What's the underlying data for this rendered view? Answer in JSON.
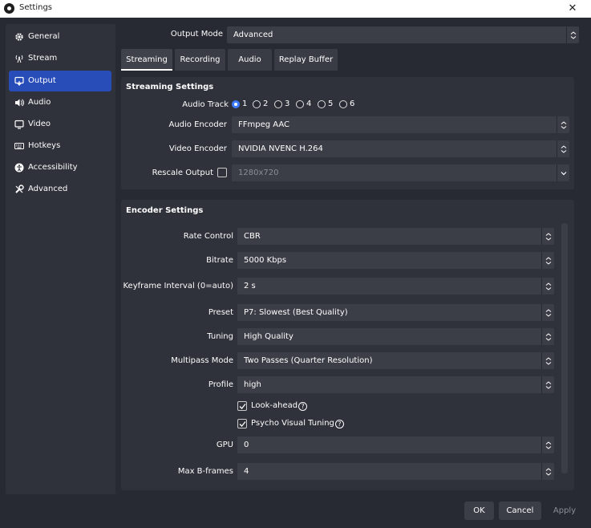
{
  "window": {
    "title": "Settings",
    "close_glyph": "✕"
  },
  "sidebar": {
    "items": [
      {
        "label": "General",
        "icon": "gear-icon"
      },
      {
        "label": "Stream",
        "icon": "antenna-icon"
      },
      {
        "label": "Output",
        "icon": "output-icon",
        "active": true
      },
      {
        "label": "Audio",
        "icon": "speaker-icon"
      },
      {
        "label": "Video",
        "icon": "monitor-icon"
      },
      {
        "label": "Hotkeys",
        "icon": "keyboard-icon"
      },
      {
        "label": "Accessibility",
        "icon": "accessibility-icon"
      },
      {
        "label": "Advanced",
        "icon": "wrench-icon"
      }
    ]
  },
  "output_mode": {
    "label": "Output Mode",
    "value": "Advanced"
  },
  "tabs": [
    {
      "label": "Streaming",
      "active": true
    },
    {
      "label": "Recording"
    },
    {
      "label": "Audio"
    },
    {
      "label": "Replay Buffer"
    }
  ],
  "streaming": {
    "title": "Streaming Settings",
    "audio_track": {
      "label": "Audio Track",
      "options": [
        "1",
        "2",
        "3",
        "4",
        "5",
        "6"
      ],
      "selected": "1"
    },
    "audio_encoder": {
      "label": "Audio Encoder",
      "value": "FFmpeg AAC"
    },
    "video_encoder": {
      "label": "Video Encoder",
      "value": "NVIDIA NVENC H.264"
    },
    "rescale": {
      "label": "Rescale Output",
      "checked": false,
      "value": "1280x720"
    }
  },
  "encoder": {
    "title": "Encoder Settings",
    "rate_control": {
      "label": "Rate Control",
      "value": "CBR"
    },
    "bitrate": {
      "label": "Bitrate",
      "value": "5000 Kbps"
    },
    "keyframe": {
      "label": "Keyframe Interval (0=auto)",
      "value": "2 s"
    },
    "preset": {
      "label": "Preset",
      "value": "P7: Slowest (Best Quality)"
    },
    "tuning": {
      "label": "Tuning",
      "value": "High Quality"
    },
    "multipass": {
      "label": "Multipass Mode",
      "value": "Two Passes (Quarter Resolution)"
    },
    "profile": {
      "label": "Profile",
      "value": "high"
    },
    "lookahead": {
      "label": "Look-ahead",
      "checked": true
    },
    "psycho": {
      "label": "Psycho Visual Tuning",
      "checked": true
    },
    "gpu": {
      "label": "GPU",
      "value": "0"
    },
    "bframes": {
      "label": "Max B-frames",
      "value": "4"
    },
    "help_glyph": "?"
  },
  "buttons": {
    "ok": "OK",
    "cancel": "Cancel",
    "apply": "Apply"
  },
  "colors": {
    "accent": "#284cb8",
    "background": "#272a33",
    "panel": "#2f323b",
    "field": "#3b3e47",
    "radio_checked": "#3d7aff"
  }
}
